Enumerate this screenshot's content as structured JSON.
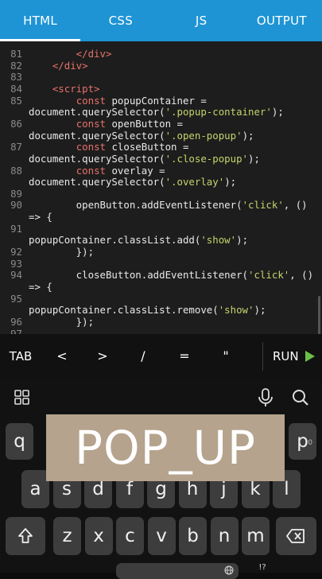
{
  "tabs": [
    "HTML",
    "CSS",
    "JS",
    "OUTPUT"
  ],
  "code_lines": [
    {
      "n": "81",
      "text": "        </div>",
      "cls": "c-tag"
    },
    {
      "n": "82",
      "text": "    </div>",
      "cls": "c-tag"
    },
    {
      "n": "83",
      "text": "",
      "cls": "c-id"
    },
    {
      "n": "84",
      "text": "    <script>",
      "cls": "c-tag"
    },
    {
      "n": "85",
      "text": "        const popupContainer =",
      "cls": "c-id"
    },
    {
      "n": "",
      "text": "document.querySelector('.popup-container');",
      "cls": "c-id"
    },
    {
      "n": "86",
      "text": "        const openButton =",
      "cls": "c-id"
    },
    {
      "n": "",
      "text": "document.querySelector('.open-popup');",
      "cls": "c-id"
    },
    {
      "n": "87",
      "text": "        const closeButton =",
      "cls": "c-id"
    },
    {
      "n": "",
      "text": "document.querySelector('.close-popup');",
      "cls": "c-id"
    },
    {
      "n": "88",
      "text": "        const overlay =",
      "cls": "c-id"
    },
    {
      "n": "",
      "text": "document.querySelector('.overlay');",
      "cls": "c-id"
    },
    {
      "n": "89",
      "text": "",
      "cls": "c-id"
    },
    {
      "n": "90",
      "text": "        openButton.addEventListener('click', ()",
      "cls": "c-id"
    },
    {
      "n": "",
      "text": "=> {",
      "cls": "c-id"
    },
    {
      "n": "91",
      "text": "",
      "cls": "c-id"
    },
    {
      "n": "",
      "text": "popupContainer.classList.add('show');",
      "cls": "c-id"
    },
    {
      "n": "92",
      "text": "        });",
      "cls": "c-id"
    },
    {
      "n": "93",
      "text": "",
      "cls": "c-id"
    },
    {
      "n": "94",
      "text": "        closeButton.addEventListener('click', ()",
      "cls": "c-id"
    },
    {
      "n": "",
      "text": "=> {",
      "cls": "c-id"
    },
    {
      "n": "95",
      "text": "",
      "cls": "c-id"
    },
    {
      "n": "",
      "text": "popupContainer.classList.remove('show');",
      "cls": "c-id"
    },
    {
      "n": "96",
      "text": "        });",
      "cls": "c-id"
    },
    {
      "n": "97",
      "text": "",
      "cls": "c-id"
    }
  ],
  "toolbar": {
    "tab": "TAB",
    "lt": "<",
    "gt": ">",
    "slash": "/",
    "eq": "=",
    "quote": "\"",
    "run": "RUN"
  },
  "banner": "POP_UP",
  "keyboard": {
    "row1": [
      {
        "k": "q",
        "s": ""
      },
      {
        "k": "p",
        "s": "0"
      }
    ],
    "row2": [
      "a",
      "s",
      "d",
      "f",
      "g",
      "h",
      "j",
      "k",
      "l"
    ],
    "row3": [
      "z",
      "x",
      "c",
      "v",
      "b",
      "n",
      "m"
    ],
    "symkey": "!?"
  },
  "colors": {
    "accent": "#1e94d4",
    "run": "#6cc04a",
    "banner": "#b5a38d"
  }
}
